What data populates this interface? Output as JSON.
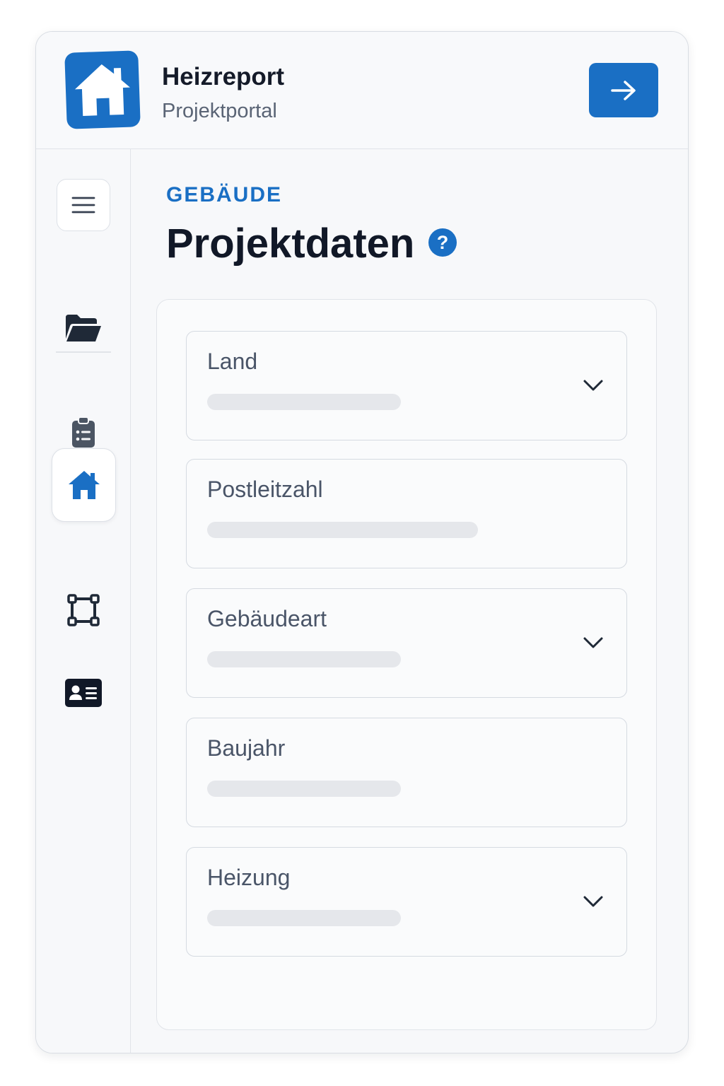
{
  "header": {
    "app_title": "Heizreport",
    "app_subtitle": "Projektportal",
    "logo_icon": "house-icon",
    "go_icon": "arrow-right-icon"
  },
  "sidebar": {
    "items": [
      {
        "icon": "menu-icon"
      },
      {
        "icon": "folder-open-icon"
      },
      {
        "icon": "clipboard-list-icon"
      },
      {
        "icon": "house-icon",
        "active": true
      },
      {
        "icon": "floor-plan-icon"
      },
      {
        "icon": "id-card-icon"
      }
    ]
  },
  "main": {
    "section_label": "GEBÄUDE",
    "page_title": "Projektdaten",
    "help_glyph": "?",
    "fields": [
      {
        "label": "Land",
        "type": "dropdown",
        "value": ""
      },
      {
        "label": "Postleitzahl",
        "type": "text",
        "value": ""
      },
      {
        "label": "Gebäudeart",
        "type": "dropdown",
        "value": ""
      },
      {
        "label": "Baujahr",
        "type": "text",
        "value": ""
      },
      {
        "label": "Heizung",
        "type": "dropdown",
        "value": ""
      }
    ]
  },
  "colors": {
    "accent": "#1a6fc4",
    "text_dark": "#111827",
    "text_muted": "#4a5568",
    "placeholder_bar": "#e5e7eb"
  }
}
